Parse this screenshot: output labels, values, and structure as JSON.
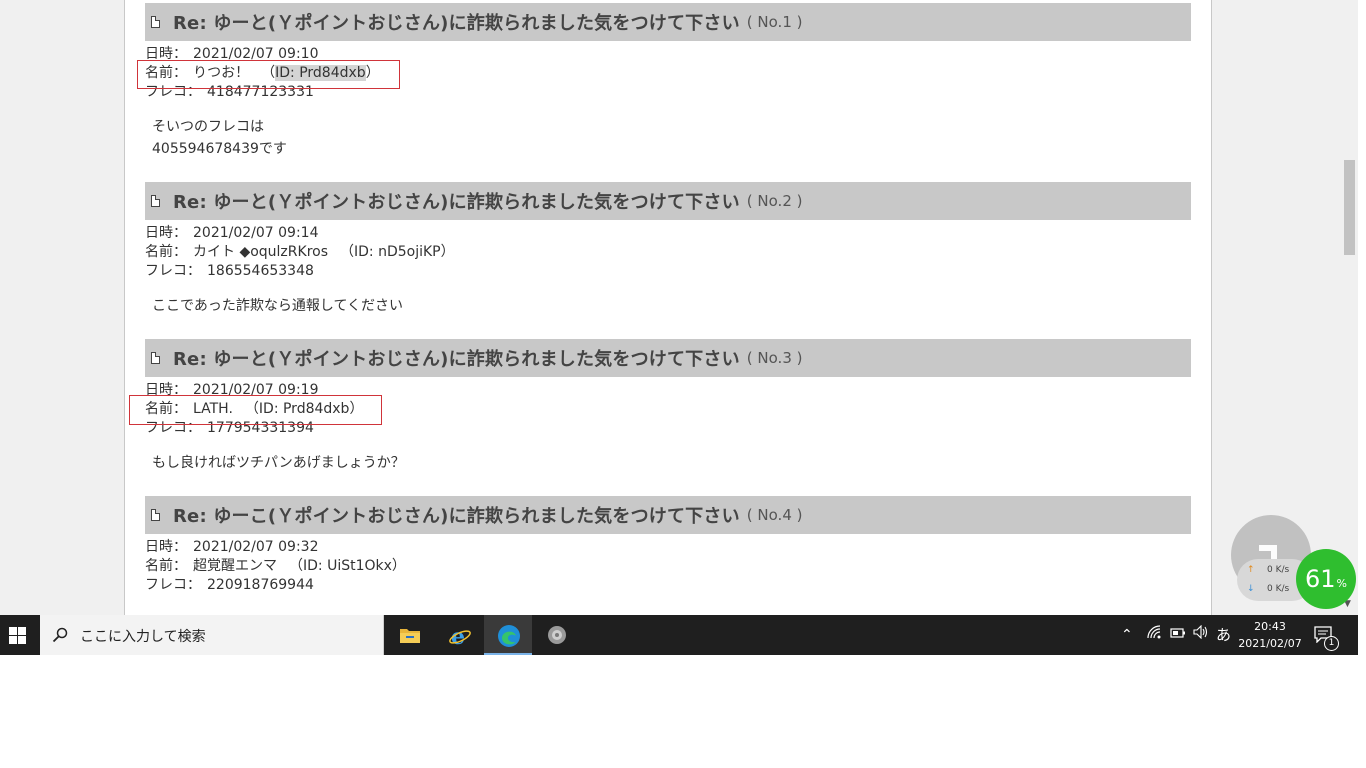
{
  "posts": [
    {
      "title": "Re: ゆーと(Ｙポイントおじさん)に詐欺られました気をつけて下さい",
      "no": "( No.1 )",
      "date_label": "日時：",
      "date": "2021/02/07 09:10",
      "name_label": "名前：",
      "name": "りつお！",
      "id_open": "（",
      "id": "ID: Prd84dxb",
      "id_close": "）",
      "fc_label": "フレコ：",
      "fc": "418477123331",
      "body": [
        "そいつのフレコは",
        "405594678439です"
      ]
    },
    {
      "title": "Re: ゆーと(Ｙポイントおじさん)に詐欺られました気をつけて下さい",
      "no": "( No.2 )",
      "date_label": "日時：",
      "date": "2021/02/07 09:14",
      "name_label": "名前：",
      "name": "カイト ◆oqulzRKros",
      "id_full": "（ID: nD5ojiKP）",
      "fc_label": "フレコ：",
      "fc": "186554653348",
      "body": [
        "ここであった詐欺なら通報してください"
      ]
    },
    {
      "title": "Re: ゆーと(Ｙポイントおじさん)に詐欺られました気をつけて下さい",
      "no": "( No.3 )",
      "date_label": "日時：",
      "date": "2021/02/07 09:19",
      "name_label": "名前：",
      "name": "LATH.",
      "id_full": "（ID: Prd84dxb）",
      "fc_label": "フレコ：",
      "fc": "177954331394",
      "body": [
        "もし良ければツチパンあげましょうか？"
      ]
    },
    {
      "title": "Re: ゆーこ(Ｙポイントおじさん)に詐欺られました気をつけて下さい",
      "no": "( No.4 )",
      "date_label": "日時：",
      "date": "2021/02/07 09:32",
      "name_label": "名前：",
      "name": "超覚醒エンマ",
      "id_full": "（ID: UiSt1Okx）",
      "fc_label": "フレコ：",
      "fc": "220918769944"
    }
  ],
  "net_monitor": {
    "upload": "0",
    "download": "0",
    "unit": "K/s",
    "cpu_percent": "61",
    "cpu_unit": "%",
    "accent_color": "#2fbe2f"
  },
  "taskbar": {
    "search_placeholder": "ここに入力して検索",
    "apps": [
      "file-explorer-icon",
      "internet-explorer-icon",
      "edge-icon",
      "speaker-app-icon"
    ],
    "ime": "あ",
    "time": "20:43",
    "date": "2021/02/07",
    "notification_count": "1"
  }
}
